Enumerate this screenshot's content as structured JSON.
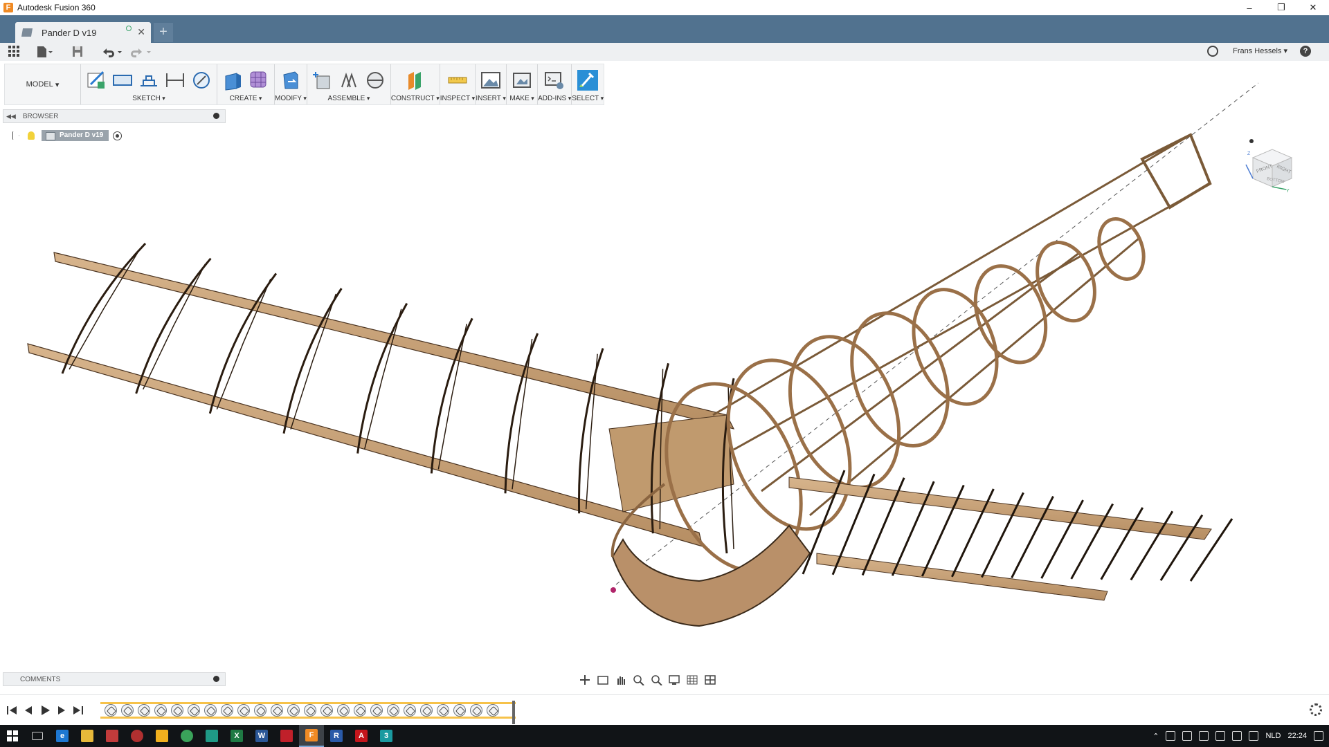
{
  "window": {
    "title": "Autodesk Fusion 360",
    "app_logo": "F"
  },
  "tab": {
    "label": "Pander D v19"
  },
  "quickaccess": {
    "user": "Frans Hessels",
    "help_glyph": "?"
  },
  "toolbar": {
    "mode": "MODEL",
    "groups": [
      {
        "label": "SKETCH"
      },
      {
        "label": "CREATE"
      },
      {
        "label": "MODIFY"
      },
      {
        "label": "ASSEMBLE"
      },
      {
        "label": "CONSTRUCT"
      },
      {
        "label": "INSPECT"
      },
      {
        "label": "INSERT"
      },
      {
        "label": "MAKE"
      },
      {
        "label": "ADD-INS"
      },
      {
        "label": "SELECT"
      }
    ]
  },
  "browser": {
    "title": "BROWSER",
    "root_node": "Pander D v19"
  },
  "comments": {
    "title": "COMMENTS"
  },
  "viewcube": {
    "front": "FRONT",
    "right": "RIGHT",
    "bottom": "BOTTOM",
    "axis_z": "Z",
    "axis_y": "Y"
  },
  "taskbar": {
    "language": "NLD",
    "time": "22:24"
  },
  "colors": {
    "model_wood": "#c8a27a",
    "model_edge": "#3a2a1a",
    "tab_bar": "#51728f",
    "select_accent": "#2a8fd6"
  }
}
